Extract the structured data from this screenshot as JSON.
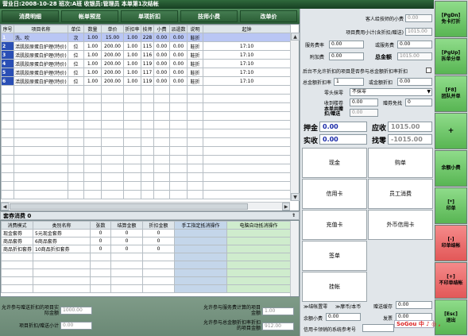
{
  "titlebar": "营业日:2008-10-28  班次:A班  收银员:管理员  本单第1次结帐",
  "tabs": [
    "消费明细",
    "帐单预览",
    "单项折扣",
    "技师小费",
    "改单价"
  ],
  "items": {
    "headers": [
      "序号",
      "项目名称",
      "单位",
      "数量",
      "单价",
      "折扣率",
      "技师",
      "小费",
      "派遣数",
      "说明",
      "起钟"
    ],
    "rows": [
      {
        "no": "1",
        "name": "洗、吹",
        "unit": "次",
        "qty": "1.00",
        "price": "15.00",
        "rate": "1.00",
        "tech": "228",
        "tip": "0.00",
        "dispatch": "0.00",
        "note": "鞋折",
        "clock": ""
      },
      {
        "no": "2",
        "name": "活肌胶原蛋白护理(特价)",
        "unit": "位",
        "qty": "1.00",
        "price": "200.00",
        "rate": "1.00",
        "tech": "115",
        "tip": "0.00",
        "dispatch": "0.00",
        "note": "鞋折",
        "clock": "17:10"
      },
      {
        "no": "3",
        "name": "活肌胶原蛋白护理(特价)",
        "unit": "位",
        "qty": "1.00",
        "price": "200.00",
        "rate": "1.00",
        "tech": "116",
        "tip": "0.00",
        "dispatch": "0.00",
        "note": "鞋折",
        "clock": "17:10"
      },
      {
        "no": "4",
        "name": "活肌胶原蛋白护理(特价)",
        "unit": "位",
        "qty": "1.00",
        "price": "200.00",
        "rate": "1.00",
        "tech": "119",
        "tip": "0.00",
        "dispatch": "0.00",
        "note": "鞋折",
        "clock": "17:10"
      },
      {
        "no": "5",
        "name": "活肌胶原蛋白护理(特价)",
        "unit": "位",
        "qty": "1.00",
        "price": "200.00",
        "rate": "1.00",
        "tech": "117",
        "tip": "0.00",
        "dispatch": "0.00",
        "note": "鞋折",
        "clock": "17:10"
      },
      {
        "no": "6",
        "name": "活肌胶原蛋白护理(特价)",
        "unit": "位",
        "qty": "1.00",
        "price": "200.00",
        "rate": "1.00",
        "tech": "119",
        "tip": "0.00",
        "dispatch": "0.00",
        "note": "鞋折",
        "clock": "17:10"
      }
    ]
  },
  "packages": {
    "title": "套券消费 0",
    "headers": [
      "消费模式",
      "类别名称",
      "张数",
      "结算金额",
      "折扣金额",
      "手工指定抵消操作",
      "电脑自动抵消操作"
    ],
    "rows": [
      {
        "mode": "现金套券",
        "name": "5元现金套券",
        "count": "0",
        "settle": "0",
        "discount": "0"
      },
      {
        "mode": "商品套券",
        "name": "6商品套券",
        "count": "0",
        "settle": "0",
        "discount": "0"
      },
      {
        "mode": "商品折扣套券",
        "name": "10商品折扣套券",
        "count": "0",
        "settle": "0",
        "discount": "0"
      }
    ]
  },
  "bottom": {
    "label1": "允许参与赠送折扣的项目实际金额",
    "value1": "1000.00",
    "label2": "项目折扣/赠送小计",
    "value2": "0.00",
    "label3": "允许参与服务费计算的项目金额",
    "value3": "1.00",
    "label4": "允许参与总金额折扣率折扣的项目金额",
    "value4": "912.00"
  },
  "right": {
    "guest_tip_label": "客人给技师的小费",
    "guest_tip": "0.00",
    "subtotal_label": "项目费用小计(含折扣/赠送)",
    "subtotal": "1015.00",
    "service_rate_label": "服务费率",
    "service_rate": "0.00",
    "service_fee_label": "或服务费",
    "service_fee": "0.00",
    "surcharge_label": "附加费",
    "surcharge": "0.00",
    "total_label": "总金额",
    "total": "1015.00",
    "note": "后台不允许折扣的项目是否参与总金额折扣率折扣",
    "total_rate_label": "总金额折扣率",
    "total_rate": "1",
    "or_discount_label": "或金额折扣",
    "or_discount": "0.00",
    "rounding_label": "零头抹零",
    "rounding": "不抹零",
    "voucher_label": "收到楼卷",
    "voucher": "0.00",
    "bill_free_label": "赠券免找",
    "bill_free": "0",
    "bill_gift_label": "本单共赠扣/赠送",
    "bill_gift": "0.00",
    "deposit_label": "押金",
    "deposit": "0.00",
    "receivable_label": "应收",
    "receivable": "1015.00",
    "received_label": "实收",
    "received": "0.00",
    "change_label": "找零",
    "change": "-1015.00",
    "payments": [
      "现金",
      "购单",
      "信用卡",
      "员工消费",
      "充值卡",
      "外币信用卡",
      "签单",
      "挂帐"
    ],
    "foot_bill_label": "≫结帐置零",
    "foot_bill_label2": "≫摩币/本币",
    "foot_gift_label": "赠送缓存",
    "foot_gift": "0.00",
    "foot_remain_label": "余额小费",
    "foot_remain": "0.00",
    "foot_invoice_label": "发票",
    "foot_invoice": "0.00",
    "foot_card_label": "信用卡领销的系统参考号",
    "foot_card": ""
  },
  "sidebar": [
    {
      "key": "[PgDn]",
      "label": "免卡打折"
    },
    {
      "key": "[PgUp]",
      "label": "拆单分单"
    },
    {
      "key": "[F8]",
      "label": "团队并单"
    },
    {
      "key": "",
      "label": "+"
    },
    {
      "key": "",
      "label": "余额小费"
    },
    {
      "key": "[*]",
      "label": "印单"
    },
    {
      "key": "[-]",
      "label": "印单结帐"
    },
    {
      "key": "[+]",
      "label": "不印单结帐"
    },
    {
      "key": "[Esc]",
      "label": "退出"
    }
  ],
  "sogou": "SoGou 中 ♪ ◎ ,"
}
